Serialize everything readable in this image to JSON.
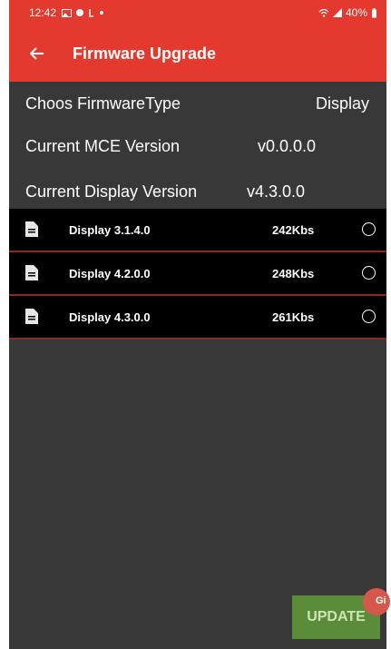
{
  "status_bar": {
    "time": "12:42",
    "battery": "40%",
    "icons": [
      "gallery-icon",
      "location-icon",
      "call-icon",
      "dot-icon",
      "wifi-icon",
      "signal-icon",
      "battery-icon"
    ]
  },
  "app_bar": {
    "title": "Firmware Upgrade",
    "back_icon": "arrow-left-icon"
  },
  "info": {
    "firmware_type_label": "Choos FirmwareType",
    "firmware_type_value": "Display",
    "mce_label": "Current MCE Version",
    "mce_value": "v0.0.0.0",
    "display_label": "Current Display Version",
    "display_value": "v4.3.0.0"
  },
  "firmware_list": [
    {
      "name": "Display 3.1.4.0",
      "size": "242Kbs",
      "selected": false,
      "icon": "document-icon"
    },
    {
      "name": "Display 4.2.0.0",
      "size": "248Kbs",
      "selected": false,
      "icon": "document-icon"
    },
    {
      "name": "Display 4.3.0.0",
      "size": "261Kbs",
      "selected": false,
      "icon": "document-icon"
    }
  ],
  "fab": {
    "glyph": "Gi",
    "icon": "floating-bubble-icon"
  },
  "actions": {
    "update_label": "UPDATE"
  },
  "colors": {
    "accent": "#e4392e",
    "background": "#383838",
    "list_bg": "#000000",
    "update_button": "#5b8c3a"
  }
}
